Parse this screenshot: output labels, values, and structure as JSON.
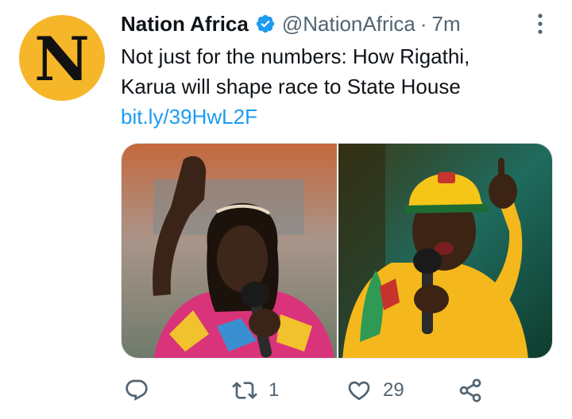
{
  "account": {
    "avatar_letter": "N",
    "display_name": "Nation Africa",
    "handle": "@NationAfrica",
    "separator": "·",
    "time": "7m",
    "brand_color": "#f5b62a",
    "verified_color": "#1d9bf0"
  },
  "tweet": {
    "text_lines": [
      "Not just for the numbers: How Rigathi,",
      "Karua will shape race to State House"
    ],
    "link": "bit.ly/39HwL2F"
  },
  "media": {
    "description_icon": "photo-collage"
  },
  "actions": {
    "reply": {
      "icon": "reply-icon",
      "count": ""
    },
    "retweet": {
      "icon": "retweet-icon",
      "count": "1"
    },
    "like": {
      "icon": "heart-icon",
      "count": "29"
    },
    "share": {
      "icon": "share-icon",
      "count": ""
    }
  }
}
